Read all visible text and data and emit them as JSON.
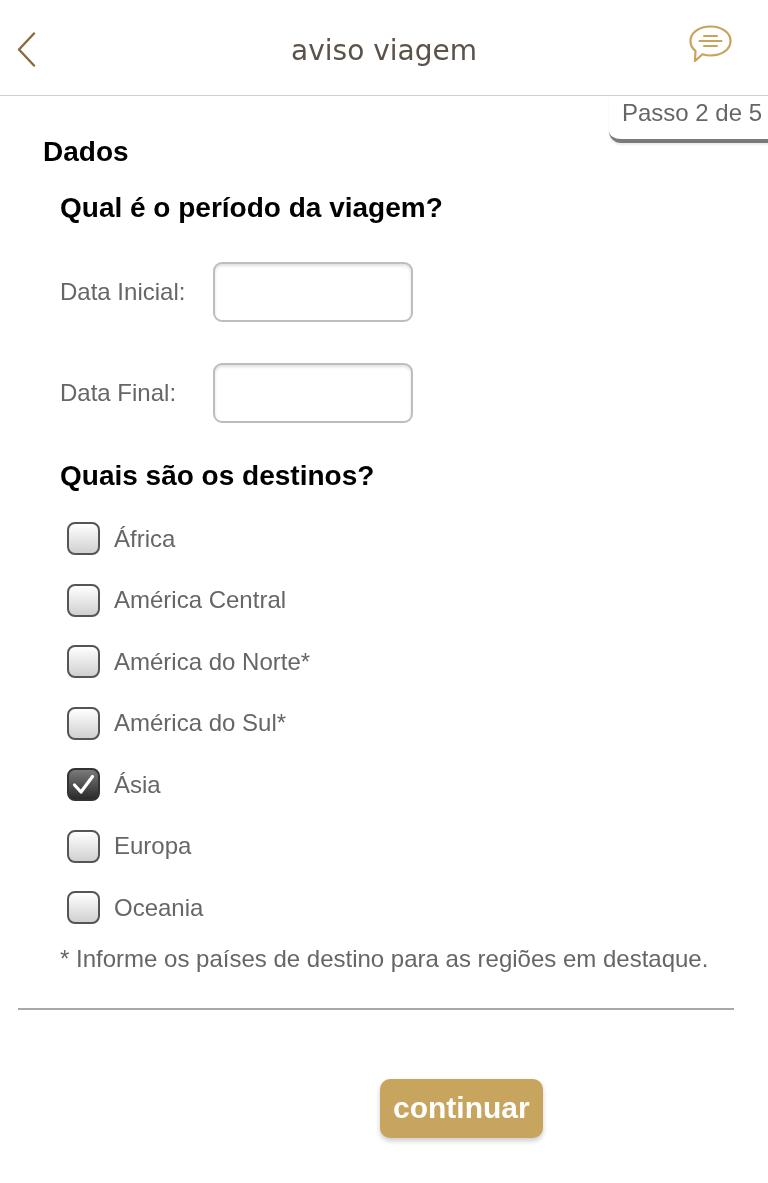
{
  "header": {
    "title": "aviso viagem"
  },
  "step": {
    "label": "Passo 2 de 5"
  },
  "section": {
    "title": "Dados"
  },
  "period": {
    "question": "Qual é o período da viagem?",
    "fields": [
      {
        "label": "Data Inicial:"
      },
      {
        "label": "Data Final:"
      }
    ]
  },
  "destinations": {
    "question": "Quais são os destinos?",
    "options": [
      {
        "label": "África",
        "checked": false
      },
      {
        "label": "América Central",
        "checked": false
      },
      {
        "label": "América do Norte*",
        "checked": false
      },
      {
        "label": "América do Sul*",
        "checked": false
      },
      {
        "label": "Ásia",
        "checked": true
      },
      {
        "label": "Europa",
        "checked": false
      },
      {
        "label": "Oceania",
        "checked": false
      }
    ],
    "note": "* Informe os países de destino para as regiões em destaque."
  },
  "buttons": [
    {
      "label": "continuar"
    }
  ]
}
